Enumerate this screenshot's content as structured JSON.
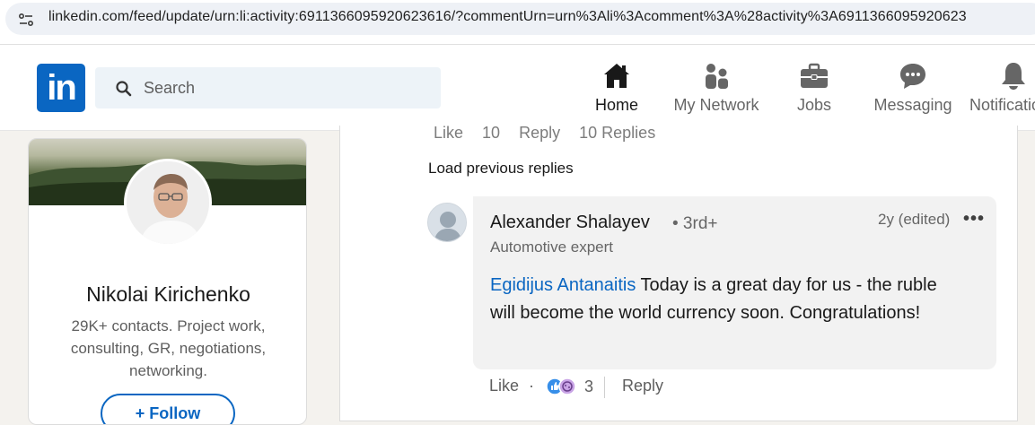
{
  "browser": {
    "url": "linkedin.com/feed/update/urn:li:activity:6911366095920623616/?commentUrn=urn%3Ali%3Acomment%3A%28activity%3A6911366095920623"
  },
  "header": {
    "logo_text": "in",
    "search": {
      "placeholder": "Search"
    },
    "nav": {
      "home": "Home",
      "network": "My Network",
      "jobs": "Jobs",
      "messaging": "Messaging",
      "notifications": "Notifications"
    }
  },
  "profile": {
    "name": "Nikolai Kirichenko",
    "headline": "29K+ contacts. Project work, consulting, GR, negotiations, networking.",
    "follow_label": "+ Follow"
  },
  "feed": {
    "previous_reply_actions": {
      "like": "Like",
      "count": "10",
      "reply": "Reply",
      "replies": "10 Replies"
    },
    "load_previous": "Load previous replies",
    "comment": {
      "author": "Alexander Shalayev",
      "degree": "• 3rd+",
      "headline": "Automotive expert",
      "time": "2y (edited)",
      "more": "•••",
      "mention": "Egidijus Antanaitis",
      "text": " Today is a great day for us - the ruble will become the world currency soon. Congratulations!",
      "like_label": "Like",
      "dot": "·",
      "reaction_count": "3",
      "reply_label": "Reply"
    }
  },
  "colors": {
    "linkedin_blue": "#0a66c2",
    "text_primary": "#191919",
    "text_secondary": "#666666"
  }
}
